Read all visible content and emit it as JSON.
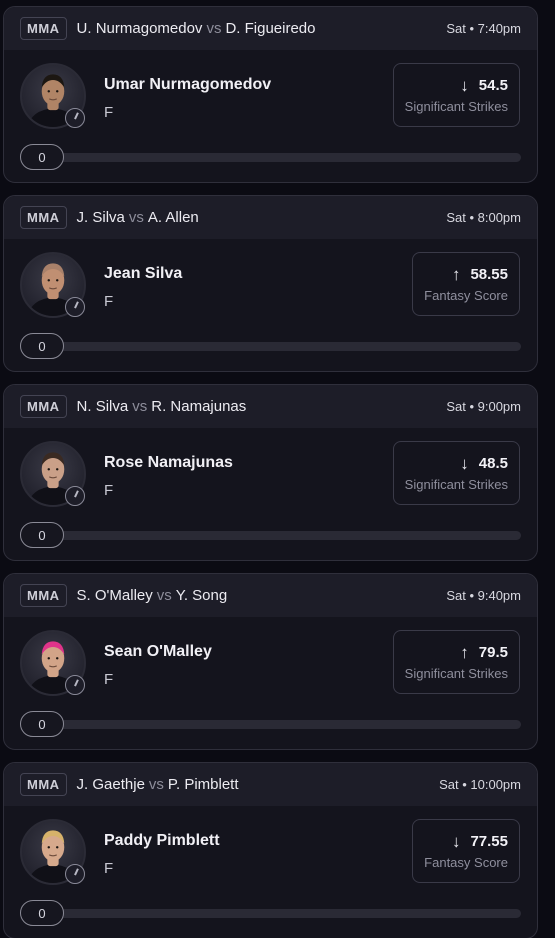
{
  "cards": [
    {
      "sport": "MMA",
      "team_a": "U. Nurmagomedov",
      "vs": "vs",
      "team_b": "D. Figueiredo",
      "time": "Sat • 7:40pm",
      "player": "Umar Nurmagomedov",
      "position": "F",
      "direction": "down",
      "arrow": "↓",
      "line": "54.5",
      "stat": "Significant Strikes",
      "progress": "0",
      "progress_fraction": 0,
      "hair_color": "#1c1712",
      "skin_color": "#b08466"
    },
    {
      "sport": "MMA",
      "team_a": "J. Silva",
      "vs": "vs",
      "team_b": "A. Allen",
      "time": "Sat • 8:00pm",
      "player": "Jean Silva",
      "position": "F",
      "direction": "up",
      "arrow": "↑",
      "line": "58.55",
      "stat": "Fantasy Score",
      "progress": "0",
      "progress_fraction": 0,
      "hair_color": "#a9816a",
      "skin_color": "#c08f72"
    },
    {
      "sport": "MMA",
      "team_a": "N. Silva",
      "vs": "vs",
      "team_b": "R. Namajunas",
      "time": "Sat • 9:00pm",
      "player": "Rose Namajunas",
      "position": "F",
      "direction": "down",
      "arrow": "↓",
      "line": "48.5",
      "stat": "Significant Strikes",
      "progress": "0",
      "progress_fraction": 0,
      "hair_color": "#3a2a22",
      "skin_color": "#caa088"
    },
    {
      "sport": "MMA",
      "team_a": "S. O'Malley",
      "vs": "vs",
      "team_b": "Y. Song",
      "time": "Sat • 9:40pm",
      "player": "Sean O'Malley",
      "position": "F",
      "direction": "up",
      "arrow": "↑",
      "line": "79.5",
      "stat": "Significant Strikes",
      "progress": "0",
      "progress_fraction": 0,
      "hair_color": "#e0348a",
      "skin_color": "#d2a488"
    },
    {
      "sport": "MMA",
      "team_a": "J. Gaethje",
      "vs": "vs",
      "team_b": "P. Pimblett",
      "time": "Sat • 10:00pm",
      "player": "Paddy Pimblett",
      "position": "F",
      "direction": "down",
      "arrow": "↓",
      "line": "77.55",
      "stat": "Fantasy Score",
      "progress": "0",
      "progress_fraction": 0,
      "hair_color": "#d6b26a",
      "skin_color": "#d6a98c"
    }
  ]
}
